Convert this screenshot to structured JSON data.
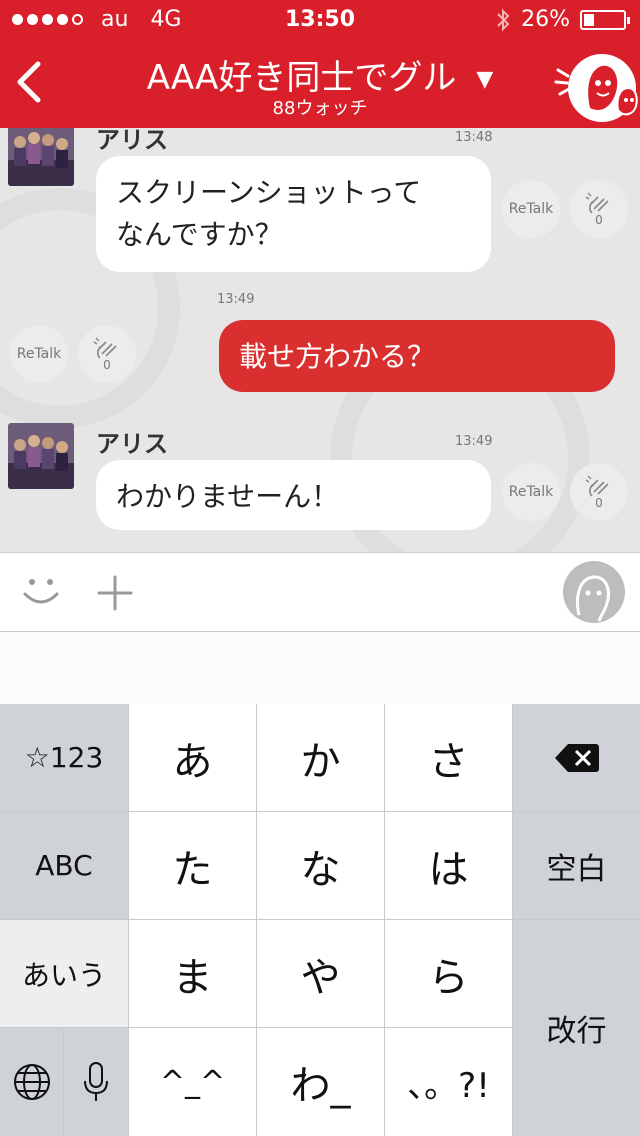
{
  "status_bar": {
    "carrier": "au",
    "network": "4G",
    "time": "13:50",
    "battery": "26%",
    "battery_level": 0.26
  },
  "header": {
    "title": "AAA好き同士でグル",
    "subtitle": "88ウォッチ",
    "color": "#d9202a"
  },
  "messages": [
    {
      "sender": "アリス",
      "time": "13:48",
      "text_lines": [
        "スクリーンショットって",
        "なんですか？"
      ],
      "retalk": "ReTalk",
      "claps": "0"
    },
    {
      "time": "13:49",
      "text": "載せ方わかる？",
      "retalk": "ReTalk",
      "claps": "0",
      "own": true
    },
    {
      "sender": "アリス",
      "time": "13:49",
      "text": "わかりませーん！",
      "retalk": "ReTalk",
      "claps": "0"
    }
  ],
  "keyboard": {
    "mode_key": "☆123",
    "abc_key": "ABC",
    "kana_mode_key": "あいう",
    "kana": [
      "あ",
      "か",
      "さ",
      "た",
      "な",
      "は",
      "ま",
      "や",
      "ら"
    ],
    "emoticon_key": "^_^",
    "wa_key": "わ_",
    "punct_key": "、。?!",
    "space_key": "空白",
    "return_key": "改行"
  }
}
